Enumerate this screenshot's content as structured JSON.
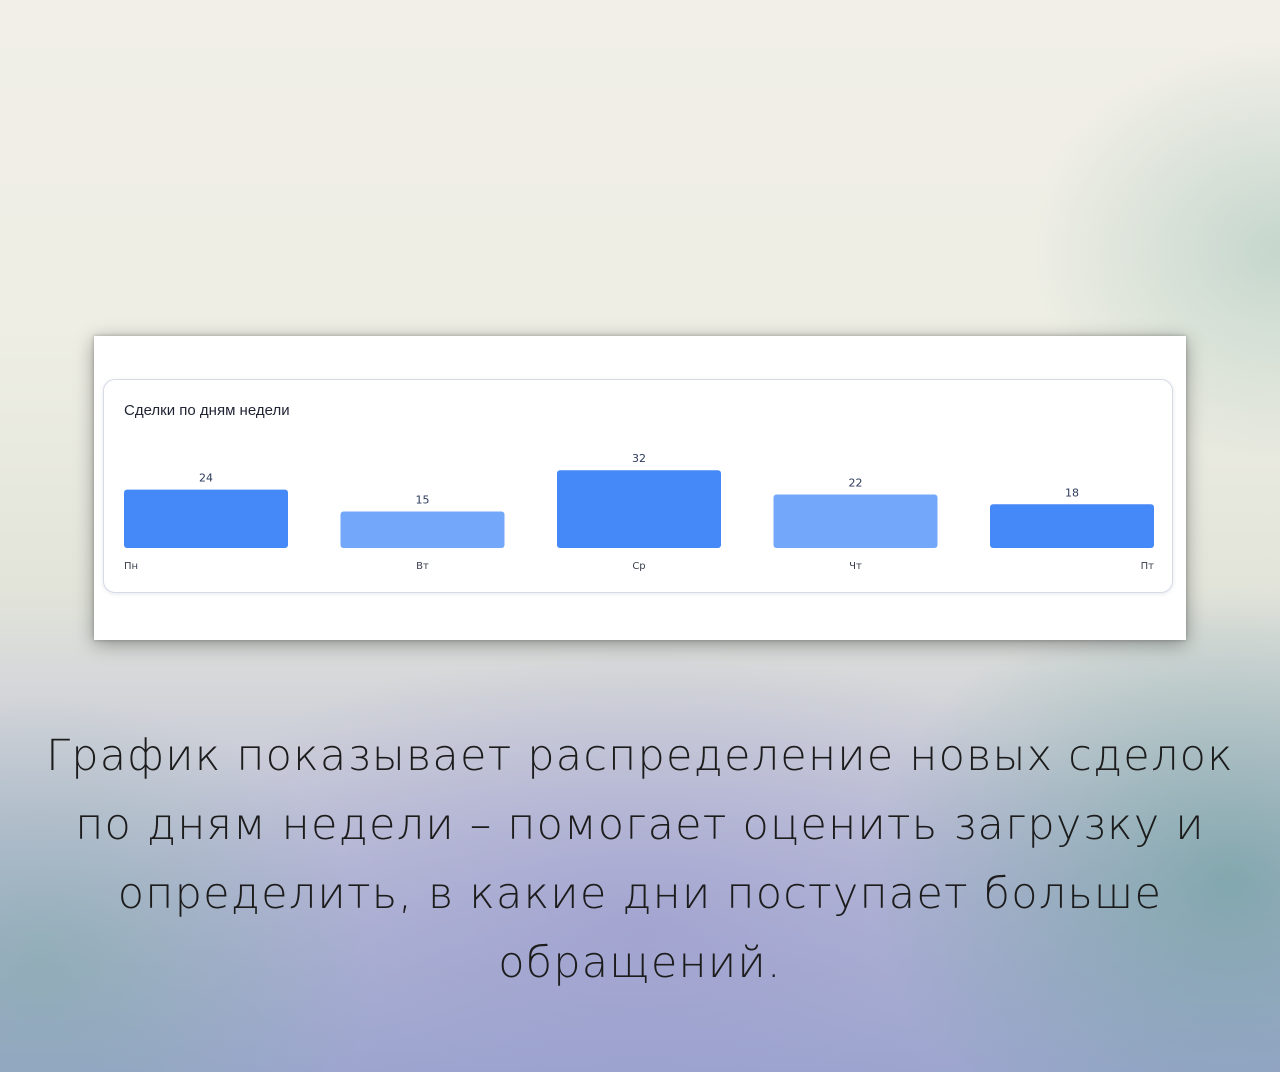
{
  "card": {
    "title": "Сделки по дням недели"
  },
  "chart_data": {
    "type": "bar",
    "categories": [
      "Пн",
      "Вт",
      "Ср",
      "Чт",
      "Пт"
    ],
    "values": [
      24,
      15,
      32,
      22,
      18
    ],
    "colors": [
      "#4589f8",
      "#72a7fa",
      "#4589f8",
      "#72a7fa",
      "#4589f8"
    ],
    "title": "Сделки по дням недели",
    "data_labels": true,
    "grid": false,
    "legend": "none"
  },
  "caption": "График показывает распределение новых сделок по дням недели – помогает оценить загрузку и определить, в какие дни поступает больше обращений."
}
